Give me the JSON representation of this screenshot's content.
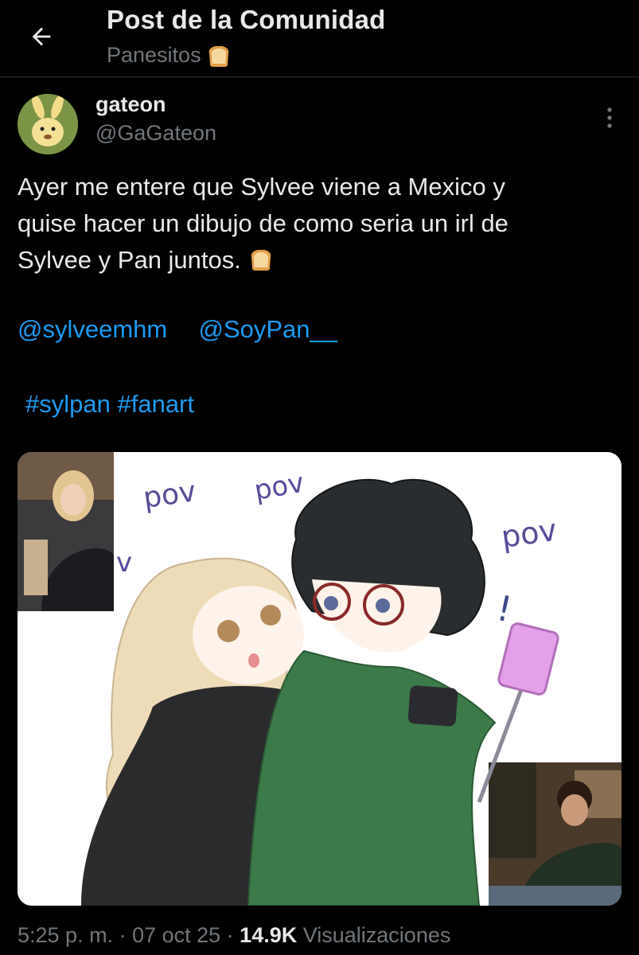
{
  "header": {
    "title": "Post de la Comunidad",
    "community": "Panesitos"
  },
  "author": {
    "name": "gateon",
    "handle": "@GaGateon"
  },
  "post": {
    "lines": [
      "Ayer me entere que Sylvee viene a Mexico y",
      "quise hacer un dibujo de como seria un irl de",
      "Sylvee y Pan juntos."
    ],
    "mentions": [
      "@sylveemhm",
      "@SoyPan__"
    ],
    "hashtags": [
      "#sylpan",
      "#fanart"
    ]
  },
  "image": {
    "pov_labels": [
      "pov",
      "pov",
      "pov",
      "v"
    ],
    "exclaim": "!"
  },
  "meta": {
    "time": "5:25 p. m.",
    "sep1": " · ",
    "date": "07 oct 25",
    "sep2": " · ",
    "views": "14.9K",
    "views_label": " Visualizaciones"
  },
  "icons": {
    "back": "arrow-left-icon",
    "bread": "bread-emoji-icon",
    "more": "more-vertical-icon"
  },
  "colors": {
    "background": "#000000",
    "text": "#e7e9ea",
    "secondary": "#71767b",
    "link": "#1d9bf0",
    "divider": "#2f3336"
  }
}
